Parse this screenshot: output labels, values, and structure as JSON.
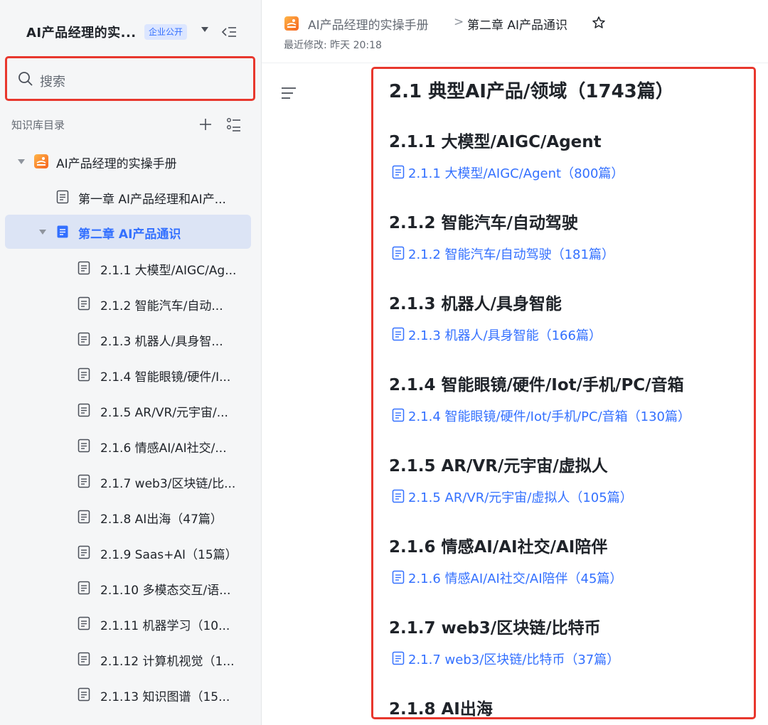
{
  "sidebar": {
    "kb_title": "AI产品经理的实...",
    "badge": "企业公开",
    "search_placeholder": "搜索",
    "directory_label": "知识库目录",
    "root": {
      "label": "AI产品经理的实操手册"
    },
    "items": [
      {
        "label": "第一章 AI产品经理和AI产..."
      },
      {
        "label": "第二章 AI产品通识",
        "active": true
      },
      {
        "label": "2.1.1 大模型/AIGC/Ag..."
      },
      {
        "label": "2.1.2 智能汽车/自动..."
      },
      {
        "label": "2.1.3 机器人/具身智..."
      },
      {
        "label": "2.1.4 智能眼镜/硬件/I..."
      },
      {
        "label": "2.1.5 AR/VR/元宇宙/..."
      },
      {
        "label": "2.1.6 情感AI/AI社交/..."
      },
      {
        "label": "2.1.7 web3/区块链/比..."
      },
      {
        "label": "2.1.8 AI出海（47篇）"
      },
      {
        "label": "2.1.9 Saas+AI（15篇）"
      },
      {
        "label": "2.1.10 多模态交互/语..."
      },
      {
        "label": "2.1.11 机器学习（10..."
      },
      {
        "label": "2.1.12 计算机视觉（1..."
      },
      {
        "label": "2.1.13 知识图谱（15..."
      }
    ]
  },
  "header": {
    "breadcrumb_root": "AI产品经理的实操手册",
    "breadcrumb_sep": ">",
    "breadcrumb_current": "第二章 AI产品通识",
    "modified": "最近修改: 昨天 20:18"
  },
  "content": {
    "section_title": "2.1 典型AI产品/领域（1743篇）",
    "sections": [
      {
        "heading": "2.1.1 大模型/AIGC/Agent",
        "link": "2.1.1 大模型/AIGC/Agent（800篇）"
      },
      {
        "heading": "2.1.2 智能汽车/自动驾驶",
        "link": "2.1.2 智能汽车/自动驾驶（181篇）"
      },
      {
        "heading": "2.1.3 机器人/具身智能",
        "link": "2.1.3 机器人/具身智能（166篇）"
      },
      {
        "heading": "2.1.4 智能眼镜/硬件/Iot/手机/PC/音箱",
        "link": "2.1.4 智能眼镜/硬件/Iot/手机/PC/音箱（130篇）"
      },
      {
        "heading": "2.1.5 AR/VR/元宇宙/虚拟人",
        "link": "2.1.5 AR/VR/元宇宙/虚拟人（105篇）"
      },
      {
        "heading": "2.1.6 情感AI/AI社交/AI陪伴",
        "link": "2.1.6 情感AI/AI社交/AI陪伴（45篇）"
      },
      {
        "heading": "2.1.7 web3/区块链/比特币",
        "link": "2.1.7 web3/区块链/比特币（37篇）"
      },
      {
        "heading": "2.1.8 AI出海"
      }
    ]
  },
  "colors": {
    "accent": "#3370ff",
    "highlight_border": "#e8372d",
    "sidebar_bg": "#f5f6f7",
    "active_bg": "#dce4f5"
  }
}
